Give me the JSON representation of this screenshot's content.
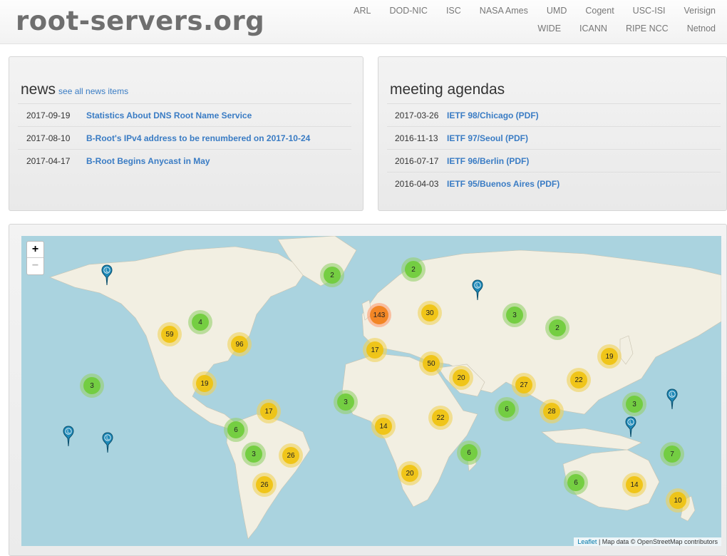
{
  "site": {
    "logo": "root-servers.org"
  },
  "nav": {
    "row1": [
      "ARL",
      "DOD-NIC",
      "ISC",
      "NASA Ames",
      "UMD",
      "Cogent",
      "USC-ISI",
      "Verisign"
    ],
    "row2": [
      "WIDE",
      "ICANN",
      "RIPE NCC",
      "Netnod"
    ]
  },
  "news": {
    "title": "news",
    "see_all": "see all news items",
    "items": [
      {
        "date": "2017-09-19",
        "title": "Statistics About DNS Root Name Service"
      },
      {
        "date": "2017-08-10",
        "title": "B-Root's IPv4 address to be renumbered on 2017-10-24"
      },
      {
        "date": "2017-04-17",
        "title": "B-Root Begins Anycast in May"
      }
    ]
  },
  "agendas": {
    "title": "meeting agendas",
    "items": [
      {
        "date": "2017-03-26",
        "title": "IETF 98/Chicago (PDF)"
      },
      {
        "date": "2016-11-13",
        "title": "IETF 97/Seoul (PDF)"
      },
      {
        "date": "2016-07-17",
        "title": "IETF 96/Berlin (PDF)"
      },
      {
        "date": "2016-04-03",
        "title": "IETF 95/Buenos Aires (PDF)"
      }
    ]
  },
  "map": {
    "zoom_in": "+",
    "zoom_out": "−",
    "pin_letter": "L",
    "attribution_link": "Leaflet",
    "attribution_text": "| Map data © OpenStreetMap contributors",
    "cluster_counts": [
      "2",
      "2",
      "3",
      "2",
      "4",
      "59",
      "96",
      "143",
      "30",
      "17",
      "50",
      "20",
      "27",
      "22",
      "19",
      "3",
      "19",
      "3",
      "17",
      "6",
      "3",
      "26",
      "26",
      "14",
      "22",
      "20",
      "6",
      "28",
      "6",
      "3",
      "7",
      "6",
      "14",
      "10"
    ],
    "cluster_levels": [
      "small",
      "small",
      "small",
      "small",
      "small",
      "medium",
      "medium",
      "large",
      "medium",
      "medium",
      "medium",
      "medium",
      "medium",
      "medium",
      "medium",
      "small",
      "medium",
      "small",
      "medium",
      "small",
      "small",
      "medium",
      "medium",
      "medium",
      "medium",
      "medium",
      "small",
      "medium",
      "small",
      "small",
      "small",
      "small",
      "medium",
      "medium"
    ],
    "colors": {
      "ocean": "#aad3df",
      "land": "#f2efe2",
      "pin": "#1d89b8"
    }
  }
}
